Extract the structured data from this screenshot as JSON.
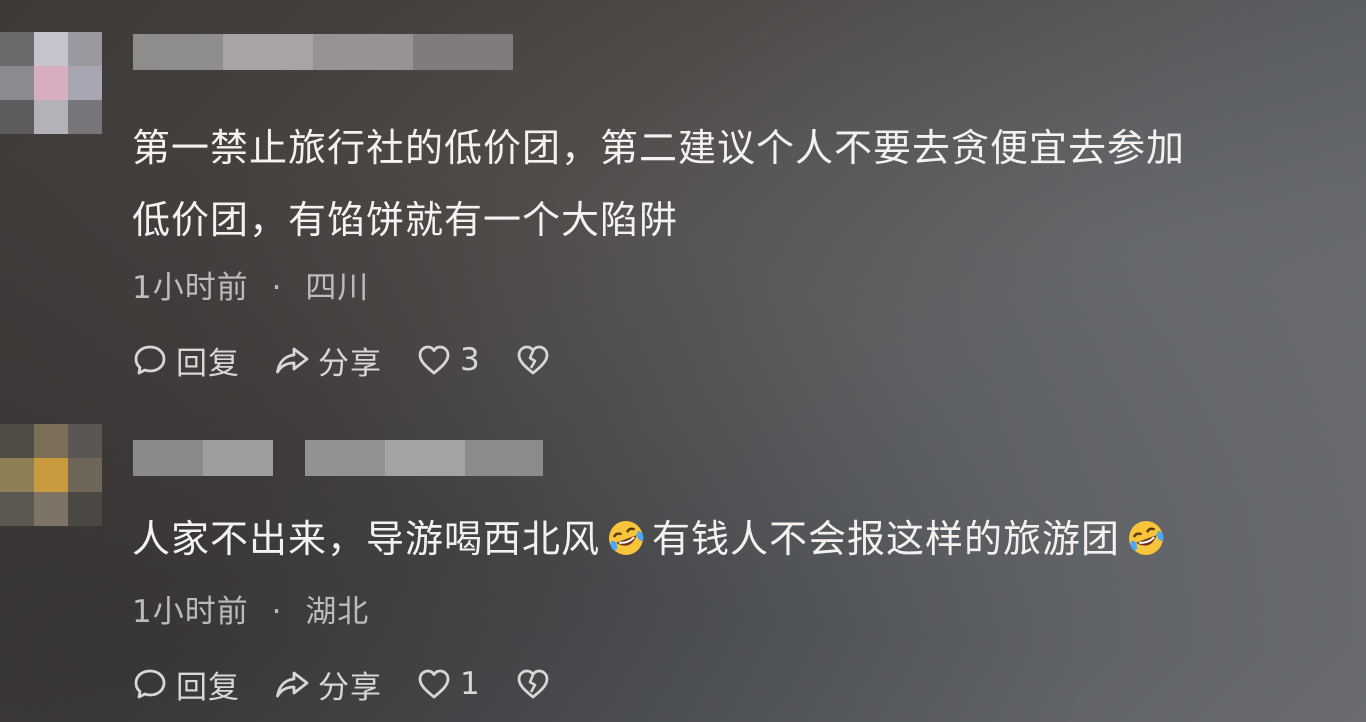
{
  "comments": [
    {
      "text_line1": "第一禁止旅行社的低价团，第二建议个人不要去贪便宜去参加",
      "text_line2": "低价团，有馅饼就有一个大陷阱",
      "time": "1小时前",
      "separator": "·",
      "location": "四川",
      "reply_label": "回复",
      "share_label": "分享",
      "likes": "3"
    },
    {
      "text_part1": "人家不出来，导游喝西北风",
      "text_part2": "有钱人不会报这样的旅游团",
      "time": "1小时前",
      "separator": "·",
      "location": "湖北",
      "reply_label": "回复",
      "share_label": "分享",
      "likes": "1"
    }
  ],
  "icons": {
    "reply": "comment-bubble-icon",
    "share": "share-arrow-icon",
    "like": "heart-icon",
    "dislike": "broken-heart-icon",
    "emoji": "rolling-on-floor-laughing-emoji"
  },
  "colors": {
    "text": "#f3f2f1",
    "meta": "#bdbcbc",
    "emoji_face": "#f7c43a"
  }
}
